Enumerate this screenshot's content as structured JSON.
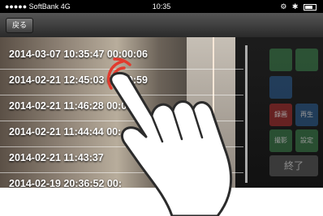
{
  "status_bar": {
    "carrier": "●●●●● SoftBank  4G",
    "time": "10:35",
    "right_icons": "⚙ ✱"
  },
  "nav": {
    "back_label": "戻る"
  },
  "recordings": [
    "2014-03-07 10:35:47 00:00:06",
    "2014-02-21 12:45:03 00:00:59",
    "2014-02-21 11:46:28 00:00:",
    "2014-02-21 11:44:44 00:",
    "2014-02-21 11:43:37",
    "2014-02-19 20:36:52 00:"
  ],
  "side_panel": {
    "labels": [
      "",
      "",
      "",
      "録画",
      "再生",
      "撮影",
      "設定"
    ],
    "end_label": "終了"
  },
  "colors": {
    "status_bar_bg": "#000000",
    "nav_bg": "#3a3a3a",
    "row_divider": "#ffffff",
    "tap_mark": "#e23b2e",
    "hand_outline": "#2b2b2b"
  },
  "gesture": {
    "icon": "tap-hand-icon"
  }
}
